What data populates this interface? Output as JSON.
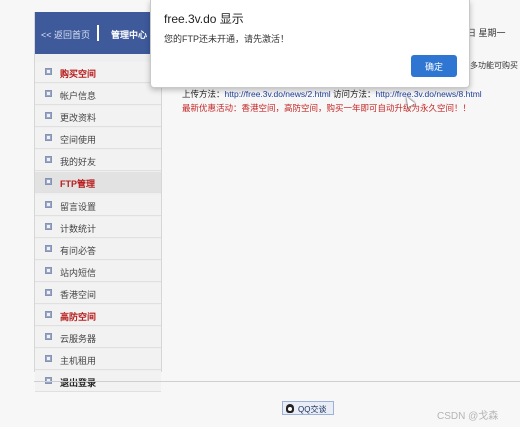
{
  "sidebar": {
    "back_label": "<< 返回首页",
    "center_label": "管理中心",
    "items": [
      {
        "label": "购买空间",
        "style": "hl"
      },
      {
        "label": "帐户信息",
        "style": "normal"
      },
      {
        "label": "更改资料",
        "style": "normal"
      },
      {
        "label": "空间使用",
        "style": "normal"
      },
      {
        "label": "我的好友",
        "style": "normal"
      },
      {
        "label": "FTP管理",
        "style": "hl"
      },
      {
        "label": "留言设置",
        "style": "normal"
      },
      {
        "label": "计数统计",
        "style": "normal"
      },
      {
        "label": "有问必答",
        "style": "normal"
      },
      {
        "label": "站内短信",
        "style": "normal"
      },
      {
        "label": "香港空间",
        "style": "normal"
      },
      {
        "label": "高防空间",
        "style": "hl"
      },
      {
        "label": "云服务器",
        "style": "normal"
      },
      {
        "label": "主机租用",
        "style": "normal"
      },
      {
        "label": "退出登录",
        "style": "bold"
      }
    ]
  },
  "main": {
    "date_fragment": "日 星期一",
    "promo_fragment": "多功能可购买",
    "upload_prefix": "上传方法：",
    "upload_url": "http://free.3v.do/news/2.html",
    "access_prefix": " 访问方法：",
    "access_url": "http://free.3v.do/news/8.html",
    "notice": "最新优惠活动：香港空间，高防空间，购买一年即可自动升级为永久空间！！"
  },
  "footer": {
    "qq_label": "QQ交谈",
    "watermark": "CSDN @戈森"
  },
  "dialog": {
    "title": "free.3v.do 显示",
    "message": "您的FTP还未开通，请先激活！",
    "ok_label": "确定"
  },
  "colors": {
    "sidebar_header": "#3e5a9b",
    "highlight_red": "#b71c1c",
    "notice_red": "#c62828",
    "ok_button": "#2f76d2"
  }
}
